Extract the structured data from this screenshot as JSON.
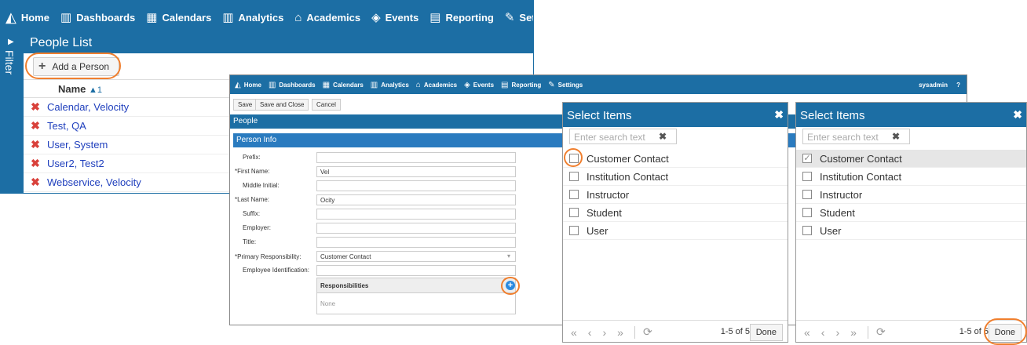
{
  "nav": {
    "items": [
      {
        "icon": "home-logo-icon",
        "glyph": "",
        "label": "Home"
      },
      {
        "icon": "bar-chart-icon",
        "glyph": "📊",
        "label": "Dashboards"
      },
      {
        "icon": "calendar-icon",
        "glyph": "📅",
        "label": "Calendars"
      },
      {
        "icon": "bar-chart-icon",
        "glyph": "📊",
        "label": "Analytics"
      },
      {
        "icon": "graduation-cap-icon",
        "glyph": "🎓",
        "label": "Academics"
      },
      {
        "icon": "ticket-icon",
        "glyph": "🎟",
        "label": "Events"
      },
      {
        "icon": "document-icon",
        "glyph": "📄",
        "label": "Reporting"
      },
      {
        "icon": "wrench-icon",
        "glyph": "🔧",
        "label": "Settings"
      }
    ],
    "user": "sysadmin",
    "help": "?"
  },
  "people_list": {
    "sidebar_label": "Filter",
    "title": "People List",
    "add_button": "Add a Person",
    "column_header": "Name",
    "sort_indicator": "▲1",
    "rows": [
      "Calendar, Velocity",
      "Test, QA",
      "User, System",
      "User2, Test2",
      "Webservice, Velocity"
    ]
  },
  "person_form": {
    "toolbar": {
      "save": "Save",
      "save_close": "Save and Close",
      "cancel": "Cancel"
    },
    "section_title": "People",
    "panel_title": "Person Info",
    "fields": [
      {
        "label": "Prefix:",
        "value": "",
        "required": false
      },
      {
        "label": "First Name:",
        "value": "Vel",
        "required": true
      },
      {
        "label": "Middle Initial:",
        "value": "",
        "required": false
      },
      {
        "label": "Last Name:",
        "value": "Ocity",
        "required": true
      },
      {
        "label": "Suffix:",
        "value": "",
        "required": false
      },
      {
        "label": "Employer:",
        "value": "",
        "required": false
      },
      {
        "label": "Title:",
        "value": "",
        "required": false
      },
      {
        "label": "Primary Responsibility:",
        "value": "Customer Contact",
        "required": true
      },
      {
        "label": "Employee Identification:",
        "value": "",
        "required": false
      }
    ],
    "responsibilities_header": "Responsibilities",
    "responsibilities_empty": "None",
    "add_icon_glyph": "+"
  },
  "select_dialog_1": {
    "title": "Select Items",
    "search_placeholder": "Enter search text",
    "options": [
      {
        "label": "Customer Contact",
        "checked": false
      },
      {
        "label": "Institution Contact",
        "checked": false
      },
      {
        "label": "Instructor",
        "checked": false
      },
      {
        "label": "Student",
        "checked": false
      },
      {
        "label": "User",
        "checked": false
      }
    ],
    "count": "1-5 of 5",
    "done": "Done"
  },
  "select_dialog_2": {
    "title": "Select Items",
    "search_placeholder": "Enter search text",
    "options": [
      {
        "label": "Customer Contact",
        "checked": true
      },
      {
        "label": "Institution Contact",
        "checked": false
      },
      {
        "label": "Instructor",
        "checked": false
      },
      {
        "label": "Student",
        "checked": false
      },
      {
        "label": "User",
        "checked": false
      }
    ],
    "count": "1-5 of 5",
    "done": "Done"
  },
  "colors": {
    "primary": "#1c6ea4",
    "highlight": "#f07f2e",
    "delete": "#d9413b",
    "link": "#1f3fbd"
  }
}
